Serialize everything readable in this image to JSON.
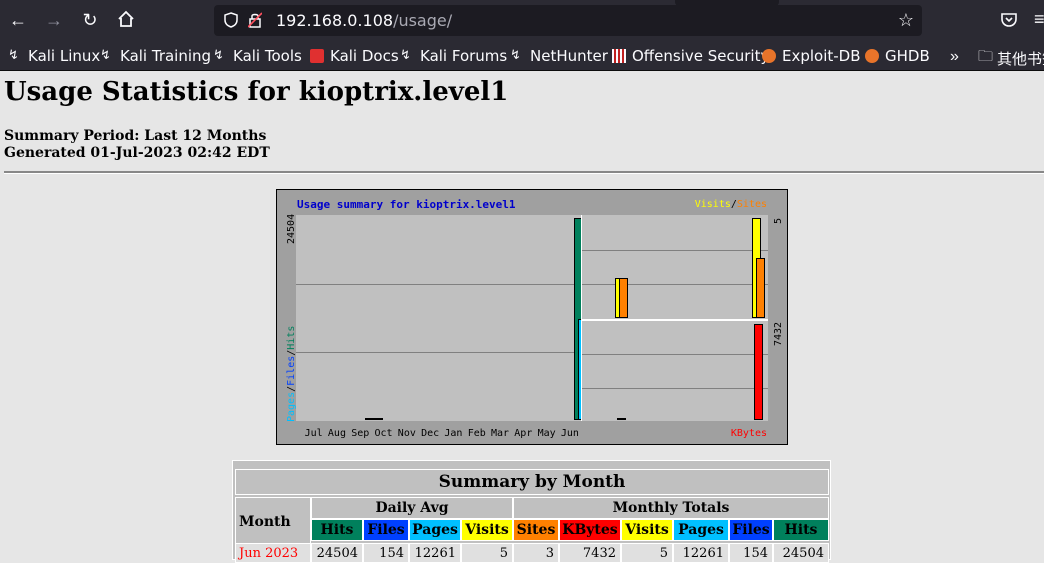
{
  "browser": {
    "url_host": "192.168.0.108",
    "url_path": "/usage/",
    "bookmarks": [
      {
        "label": "Kali Linux",
        "icon": "kali-dragon-icon"
      },
      {
        "label": "Kali Training",
        "icon": "kali-dragon-icon"
      },
      {
        "label": "Kali Tools",
        "icon": "kali-dragon-icon"
      },
      {
        "label": "Kali Docs",
        "icon": "kali-docs-icon"
      },
      {
        "label": "Kali Forums",
        "icon": "kali-dragon-icon"
      },
      {
        "label": "NetHunter",
        "icon": "nethunter-icon"
      },
      {
        "label": "Offensive Security",
        "icon": "offsec-icon"
      },
      {
        "label": "Exploit-DB",
        "icon": "exploitdb-icon"
      },
      {
        "label": "GHDB",
        "icon": "ghdb-icon"
      }
    ],
    "overflow_label": "»",
    "folder_label": "其他书签"
  },
  "page": {
    "title": "Usage Statistics for kioptrix.level1",
    "summary_period": "Summary Period: Last 12 Months",
    "generated": "Generated 01-Jul-2023 02:42 EDT"
  },
  "graph": {
    "title": "Usage summary for kioptrix.level1",
    "legend_visits": "Visits",
    "legend_sep": "/",
    "legend_sites": "Sites",
    "left_max": "24504",
    "left_legend_pages": "Pages",
    "left_legend_files": "Files",
    "left_legend_hits": "Hits",
    "right_top_max": "5",
    "right_bot_max": "7432",
    "kbytes_label": "KBytes",
    "colors": {
      "hits": "#00805c",
      "files": "#0040ff",
      "pages": "#00c0ff",
      "visits": "#ffff00",
      "sites": "#ff8000",
      "kbytes": "#ff0000"
    }
  },
  "chart_data": {
    "type": "bar",
    "title": "Usage summary for kioptrix.level1",
    "categories": [
      "Jul",
      "Aug",
      "Sep",
      "Oct",
      "Nov",
      "Dec",
      "Jan",
      "Feb",
      "Mar",
      "Apr",
      "May",
      "Jun"
    ],
    "left_panel": {
      "ymax": 24504,
      "series": [
        {
          "name": "Hits",
          "values": [
            0,
            0,
            150,
            0,
            0,
            0,
            0,
            0,
            0,
            0,
            0,
            24504
          ]
        },
        {
          "name": "Files",
          "values": [
            0,
            0,
            150,
            0,
            0,
            0,
            0,
            0,
            0,
            0,
            0,
            154
          ]
        },
        {
          "name": "Pages",
          "values": [
            0,
            0,
            0,
            0,
            0,
            0,
            0,
            0,
            0,
            0,
            0,
            12261
          ]
        }
      ]
    },
    "right_top_panel": {
      "ymax": 5,
      "series": [
        {
          "name": "Visits",
          "values": [
            0,
            0,
            2,
            0,
            0,
            0,
            0,
            0,
            0,
            0,
            0,
            5
          ]
        },
        {
          "name": "Sites",
          "values": [
            0,
            0,
            2,
            0,
            0,
            0,
            0,
            0,
            0,
            0,
            0,
            3
          ]
        }
      ]
    },
    "right_bottom_panel": {
      "ymax": 7432,
      "series": [
        {
          "name": "KBytes",
          "values": [
            0,
            0,
            20,
            0,
            0,
            0,
            0,
            0,
            0,
            0,
            0,
            7432
          ]
        }
      ]
    }
  },
  "summary_table": {
    "title": "Summary by Month",
    "month_header": "Month",
    "daily_avg_header": "Daily Avg",
    "monthly_totals_header": "Monthly Totals",
    "daily_cols": [
      {
        "label": "Hits",
        "color": "#00805c"
      },
      {
        "label": "Files",
        "color": "#0040ff"
      },
      {
        "label": "Pages",
        "color": "#00c0ff"
      },
      {
        "label": "Visits",
        "color": "#ffff00"
      }
    ],
    "monthly_cols": [
      {
        "label": "Sites",
        "color": "#ff8000"
      },
      {
        "label": "KBytes",
        "color": "#ff0000"
      },
      {
        "label": "Visits",
        "color": "#ffff00"
      },
      {
        "label": "Pages",
        "color": "#00c0ff"
      },
      {
        "label": "Files",
        "color": "#0040ff"
      },
      {
        "label": "Hits",
        "color": "#00805c"
      }
    ],
    "first_row": {
      "month": "Jun 2023",
      "values": [
        "24504",
        "154",
        "12261",
        "5",
        "3",
        "7432",
        "5",
        "12261",
        "154",
        "24504"
      ]
    }
  }
}
